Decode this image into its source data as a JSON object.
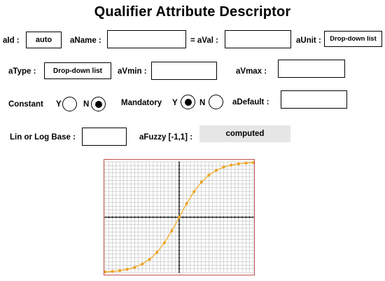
{
  "title": "Qualifier Attribute Descriptor",
  "row1": {
    "aid_label": "aId :",
    "aid_value": "auto",
    "aname_label": "aName :",
    "aval_label": "= aVal :",
    "aunit_label": "aUnit :",
    "aunit_value": "Drop-down list"
  },
  "row2": {
    "atype_label": "aType :",
    "atype_value": "Drop-down list",
    "avmin_label": "aVmin :",
    "avmax_label": "aVmax :"
  },
  "row3": {
    "constant_label": "Constant",
    "constant_y": "Y",
    "constant_n": "N",
    "constant_selected": "N",
    "mandatory_label": "Mandatory",
    "mandatory_y": "Y",
    "mandatory_n": "N",
    "mandatory_selected": "Y",
    "adefault_label": "aDefault :"
  },
  "row4": {
    "linlog_label": "Lin or Log  Base :",
    "afuzzy_label": "aFuzzy [-1,1] :",
    "afuzzy_value": "computed"
  },
  "chart_data": {
    "type": "line",
    "title": "",
    "xlabel": "",
    "ylabel": "",
    "xlim": [
      -5,
      5
    ],
    "ylim": [
      -1,
      1
    ],
    "grid": true,
    "x": [
      -5,
      -4.5,
      -4,
      -3.5,
      -3,
      -2.5,
      -2,
      -1.5,
      -1,
      -0.5,
      0,
      0.5,
      1,
      1.5,
      2,
      2.5,
      3,
      3.5,
      4,
      4.5,
      5
    ],
    "series": [
      {
        "values": [
          -0.987,
          -0.978,
          -0.964,
          -0.941,
          -0.905,
          -0.848,
          -0.762,
          -0.635,
          -0.462,
          -0.245,
          0,
          0.245,
          0.462,
          0.635,
          0.762,
          0.848,
          0.905,
          0.941,
          0.964,
          0.978,
          0.987
        ]
      }
    ],
    "colors": {
      "line": "#f2b233",
      "markers": "#f5a623",
      "axes": "#000000",
      "grid": "#b0b0b0",
      "frame": "#c0504d"
    }
  }
}
